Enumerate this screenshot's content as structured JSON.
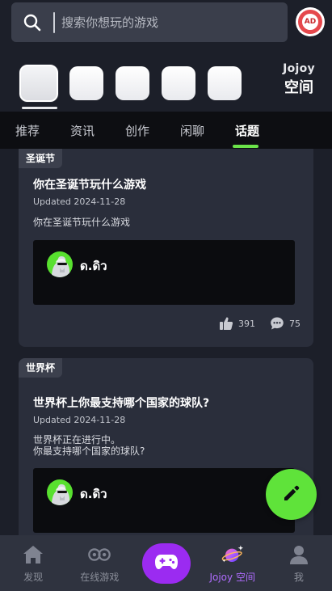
{
  "search": {
    "placeholder": "搜索你想玩的游戏",
    "icon": "search-icon"
  },
  "ad_badge": {
    "label": "AD"
  },
  "quick_tiles": [
    "",
    "",
    "",
    "",
    ""
  ],
  "space": {
    "brand": "Jojoy",
    "title": "空间"
  },
  "tabs": [
    {
      "label": "推荐",
      "active": false
    },
    {
      "label": "资讯",
      "active": false
    },
    {
      "label": "创作",
      "active": false
    },
    {
      "label": "闲聊",
      "active": false
    },
    {
      "label": "话题",
      "active": true
    }
  ],
  "cards": [
    {
      "tag": "圣诞节",
      "title": "你在圣诞节玩什么游戏",
      "updated": "Updated 2024-11-28",
      "body": "你在圣诞节玩什么游戏",
      "author": "ด.ดิว",
      "likes": "391",
      "comments": "75"
    },
    {
      "tag": "世界杯",
      "title": "世界杯上你最支持哪个国家的球队?",
      "updated": "Updated 2024-11-28",
      "body": "世界杯正在进行中。\n你最支持哪个国家的球队?",
      "author": "ด.ดิว"
    }
  ],
  "bottom_nav": [
    {
      "label": "发现",
      "icon": "home-icon"
    },
    {
      "label": "在线游戏",
      "icon": "online-game-icon"
    },
    {
      "label": "",
      "icon": "gamepad-icon"
    },
    {
      "label": "Jojoy 空间",
      "icon": "planet-icon"
    },
    {
      "label": "我",
      "icon": "profile-icon"
    }
  ],
  "colors": {
    "accent_green": "#5fe33a",
    "accent_purple": "#9b2bf1",
    "active_nav_text": "#b06cff",
    "background": "#1c1f29",
    "card": "#2a2e3b"
  }
}
